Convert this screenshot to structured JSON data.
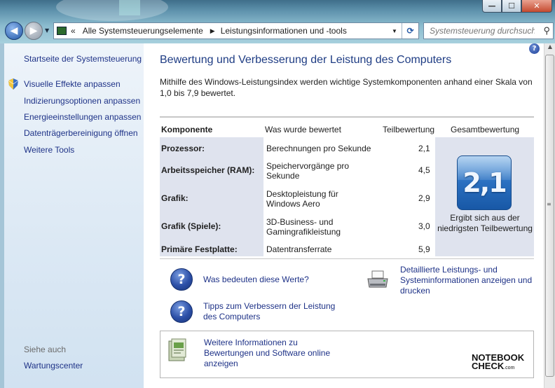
{
  "window": {
    "minimize": "—",
    "maximize": "☐",
    "close": "✕"
  },
  "nav": {
    "address_prefix": "«",
    "breadcrumb": [
      "Alle Systemsteuerungselemente",
      "Leistungsinformationen und -tools"
    ],
    "search_placeholder": "Systemsteuerung durchsuch..."
  },
  "sidebar": {
    "home": "Startseite der Systemsteuerung",
    "items": [
      "Visuelle Effekte anpassen",
      "Indizierungsoptionen anpassen",
      "Energieeinstellungen anpassen",
      "Datenträgerbereinigung öffnen",
      "Weitere Tools"
    ],
    "see_also_label": "Siehe auch",
    "see_also_items": [
      "Wartungscenter"
    ]
  },
  "main": {
    "title": "Bewertung und Verbesserung der Leistung des Computers",
    "description": "Mithilfe des Windows-Leistungsindex werden wichtige Systemkomponenten anhand einer Skala von 1,0 bis 7,9 bewertet.",
    "table": {
      "headers": [
        "Komponente",
        "Was wurde bewertet",
        "Teilbewertung",
        "Gesamtbewertung"
      ],
      "rows": [
        {
          "component": "Prozessor:",
          "rated": "Berechnungen pro Sekunde",
          "score": "2,1"
        },
        {
          "component": "Arbeitsspeicher (RAM):",
          "rated": "Speichervorgänge pro Sekunde",
          "score": "4,5"
        },
        {
          "component": "Grafik:",
          "rated": "Desktopleistung für Windows Aero",
          "score": "2,9"
        },
        {
          "component": "Grafik (Spiele):",
          "rated": "3D-Business- und Gamingrafikleistung",
          "score": "3,0"
        },
        {
          "component": "Primäre Festplatte:",
          "rated": "Datentransferrate",
          "score": "5,9"
        }
      ],
      "total_score": "2,1",
      "total_caption": "Ergibt sich aus der niedrigsten Teilbewertung"
    },
    "links": {
      "what_values_mean": "Was bedeuten diese Werte?",
      "tips": "Tipps zum Verbessern der Leistung des Computers",
      "details": "Detaillierte Leistungs- und Systeminformationen anzeigen und drucken"
    },
    "info_box": {
      "link": "Weitere Informationen zu Bewertungen und Software online anzeigen"
    },
    "watermark": {
      "line1": "NOTEBOOK",
      "line2": "CHECK",
      "suffix": ".com"
    }
  },
  "colors": {
    "link": "#1e3287",
    "title": "#1f3d84",
    "table_shade": "#dfe3ee",
    "sidebar_bg": "#dbe8f4"
  }
}
